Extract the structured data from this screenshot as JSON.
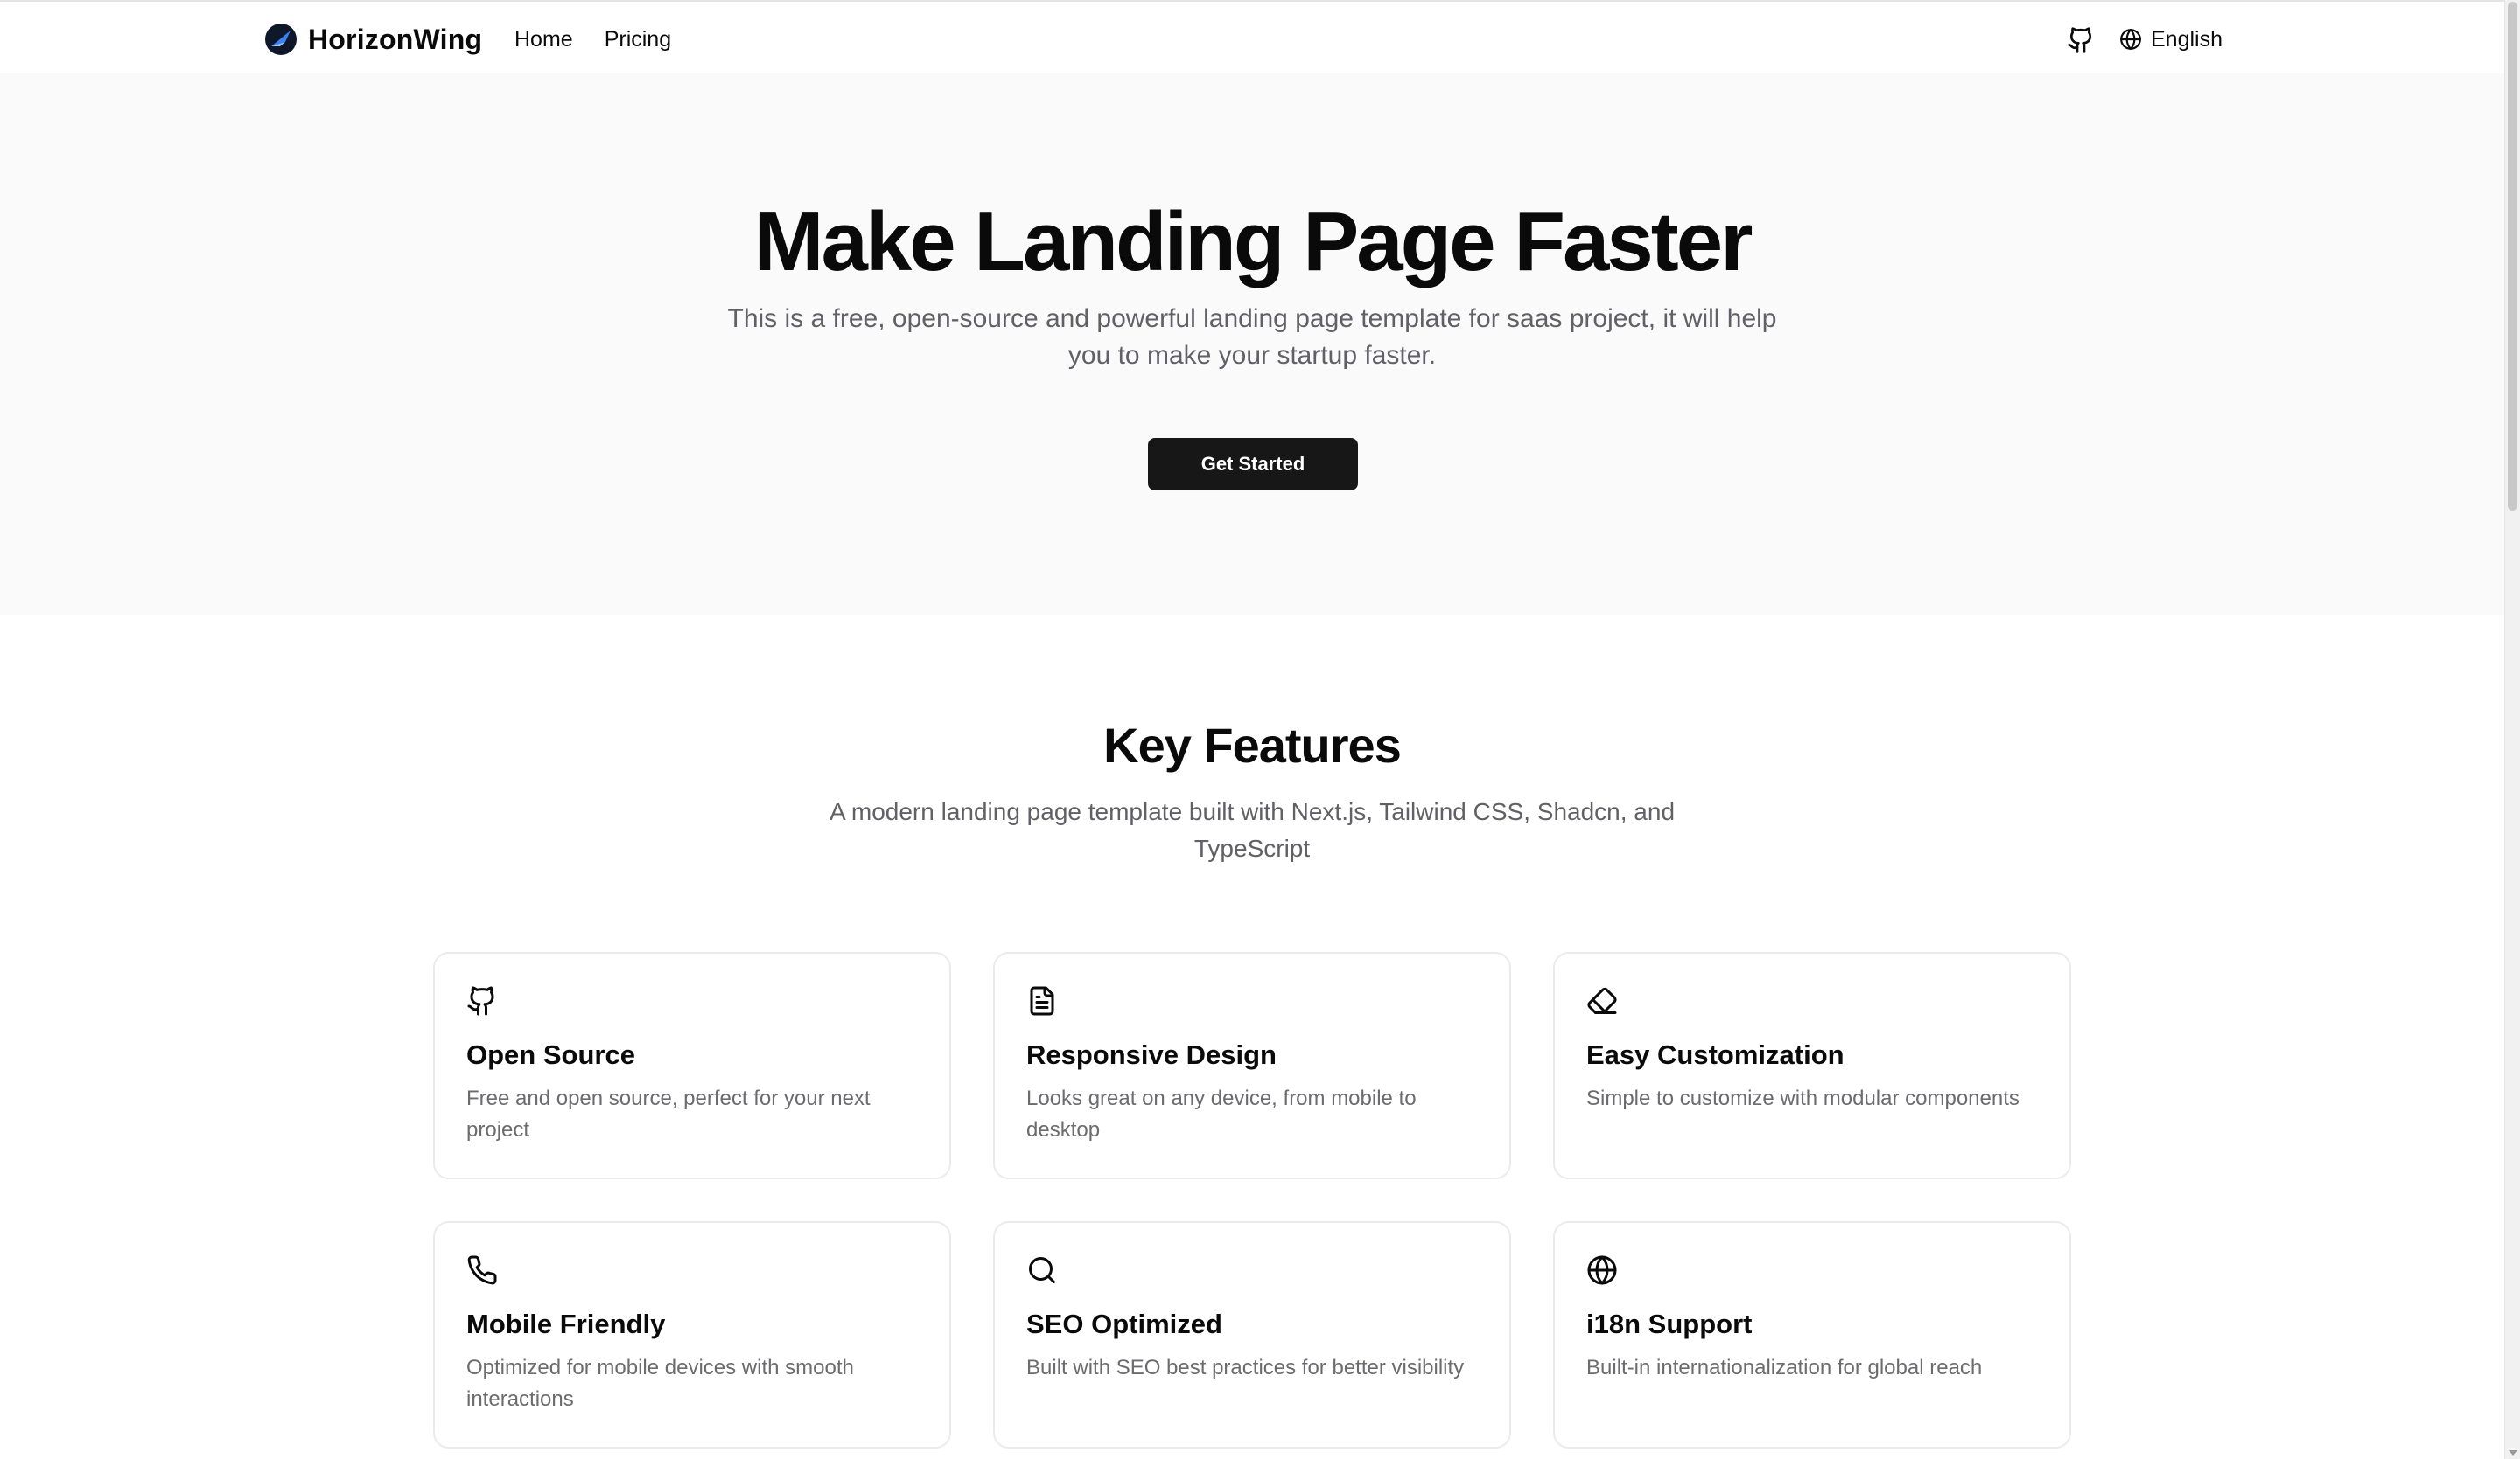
{
  "header": {
    "brand": "HorizonWing",
    "nav": [
      {
        "label": "Home"
      },
      {
        "label": "Pricing"
      }
    ],
    "github_icon": "github-icon",
    "language": "English",
    "language_icon": "globe-icon"
  },
  "hero": {
    "title": "Make Landing Page Faster",
    "subtitle": "This is a free, open-source and powerful landing page template for saas project, it will help you to make your startup faster.",
    "cta_label": "Get Started"
  },
  "features": {
    "title": "Key Features",
    "subtitle": "A modern landing page template built with Next.js, Tailwind CSS, Shadcn, and TypeScript",
    "items": [
      {
        "icon": "github-icon",
        "title": "Open Source",
        "desc": "Free and open source, perfect for your next project"
      },
      {
        "icon": "document-icon",
        "title": "Responsive Design",
        "desc": "Looks great on any device, from mobile to desktop"
      },
      {
        "icon": "eraser-icon",
        "title": "Easy Customization",
        "desc": "Simple to customize with modular components"
      },
      {
        "icon": "phone-icon",
        "title": "Mobile Friendly",
        "desc": "Optimized for mobile devices with smooth interactions"
      },
      {
        "icon": "search-icon",
        "title": "SEO Optimized",
        "desc": "Built with SEO best practices for better visibility"
      },
      {
        "icon": "globe-icon",
        "title": "i18n Support",
        "desc": "Built-in internationalization for global reach"
      }
    ]
  },
  "colors": {
    "primary_button": "#171717",
    "hero_background": "#fafafa",
    "muted_text": "#606066"
  }
}
